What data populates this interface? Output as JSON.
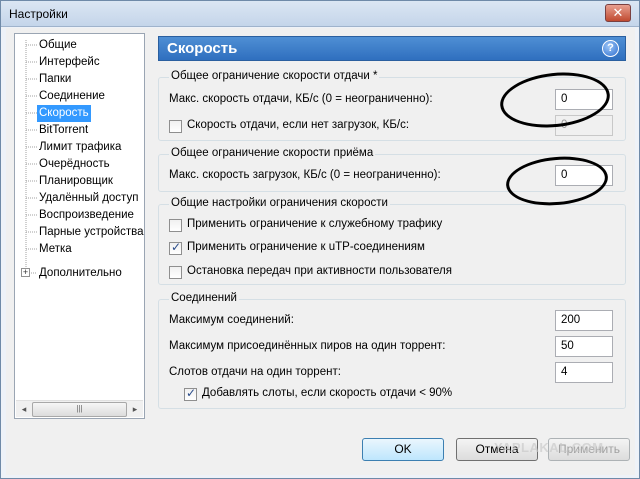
{
  "window": {
    "title": "Настройки",
    "close_glyph": "✕"
  },
  "sidebar": {
    "items": [
      {
        "label": "Общие"
      },
      {
        "label": "Интерфейс"
      },
      {
        "label": "Папки"
      },
      {
        "label": "Соединение"
      },
      {
        "label": "Скорость"
      },
      {
        "label": "BitTorrent"
      },
      {
        "label": "Лимит трафика"
      },
      {
        "label": "Очерёдность"
      },
      {
        "label": "Планировщик"
      },
      {
        "label": "Удалённый доступ"
      },
      {
        "label": "Воспроизведение"
      },
      {
        "label": "Парные устройства"
      },
      {
        "label": "Метка"
      },
      {
        "label": "Дополнительно"
      }
    ],
    "selected_index": 4,
    "expander_glyph": "+",
    "scroll_left": "◂",
    "scroll_right": "▸",
    "scroll_grip": "|||"
  },
  "panel": {
    "title": "Скорость",
    "help_glyph": "?"
  },
  "upload_group": {
    "title": "Общее ограничение скорости отдачи *",
    "max_upload_label": "Макс. скорость отдачи, КБ/с (0 = неограниченно):",
    "max_upload_value": "0",
    "no_download_label": "Скорость отдачи, если нет загрузок, КБ/с:",
    "no_download_value": "0",
    "no_download_checked": false
  },
  "download_group": {
    "title": "Общее ограничение скорости приёма",
    "max_download_label": "Макс. скорость загрузок, КБ/с (0 = неограниченно):",
    "max_download_value": "0"
  },
  "general_group": {
    "title": "Общие настройки ограничения скорости",
    "service_traffic_label": "Применить ограничение к служебному трафику",
    "service_traffic_checked": false,
    "utp_label": "Применить ограничение к uTP-соединениям",
    "utp_checked": true,
    "user_activity_label": "Остановка передач при активности пользователя",
    "user_activity_checked": false
  },
  "connections_group": {
    "title": "Соединений",
    "max_connections_label": "Максимум соединений:",
    "max_connections_value": "200",
    "max_peers_label": "Максимум присоединённых пиров на один торрент:",
    "max_peers_value": "50",
    "upload_slots_label": "Слотов отдачи на один торрент:",
    "upload_slots_value": "4",
    "extra_slots_label": "Добавлять слоты, если скорость отдачи < 90%",
    "extra_slots_checked": true
  },
  "buttons": {
    "ok": "OK",
    "cancel": "Отмена",
    "apply": "Применить"
  },
  "watermark": "YAPLAKAL.COM"
}
